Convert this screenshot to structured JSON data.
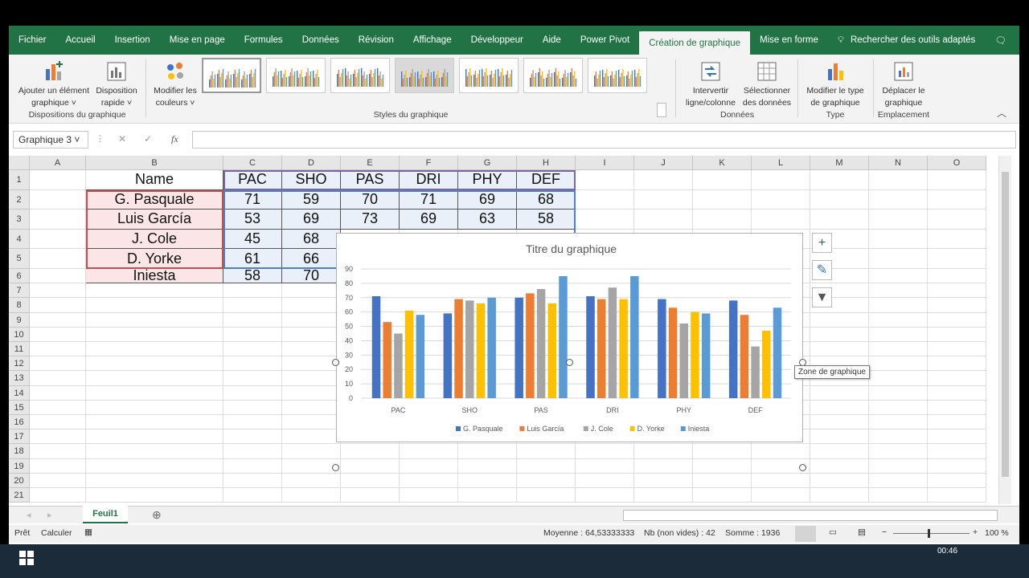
{
  "menu": {
    "tabs": [
      "Fichier",
      "Accueil",
      "Insertion",
      "Mise en page",
      "Formules",
      "Données",
      "Révision",
      "Affichage",
      "Développeur",
      "Aide",
      "Power Pivot",
      "Création de graphique",
      "Mise en forme"
    ],
    "active": "Création de graphique",
    "search": "Rechercher des outils adaptés"
  },
  "ribbon": {
    "add_element": [
      "Ajouter un élément",
      "graphique ˅"
    ],
    "quick_layout": [
      "Disposition",
      "rapide ˅"
    ],
    "group_layouts": "Dispositions du graphique",
    "change_colors": [
      "Modifier les",
      "couleurs ˅"
    ],
    "group_styles": "Styles du graphique",
    "switch_rowcol": [
      "Intervertir",
      "ligne/colonne"
    ],
    "select_data": [
      "Sélectionner",
      "des données"
    ],
    "group_data": "Données",
    "change_type": [
      "Modifier le type",
      "de graphique"
    ],
    "group_type": "Type",
    "move_chart": [
      "Déplacer le",
      "graphique"
    ],
    "group_location": "Emplacement"
  },
  "formula": {
    "namebox": "Graphique 3 ˅",
    "fx": "fx",
    "cancel": "✕",
    "confirm": "✓"
  },
  "columns": [
    "A",
    "B",
    "C",
    "D",
    "E",
    "F",
    "G",
    "H",
    "I",
    "J",
    "K",
    "L",
    "M",
    "N",
    "O"
  ],
  "rows": [
    "1",
    "2",
    "3",
    "4",
    "5",
    "6",
    "7",
    "8",
    "9",
    "10",
    "11",
    "12",
    "13",
    "14",
    "15",
    "16",
    "17",
    "18",
    "19",
    "20",
    "21"
  ],
  "table": {
    "headers": [
      "Name",
      "PAC",
      "SHO",
      "PAS",
      "DRI",
      "PHY",
      "DEF"
    ],
    "data": [
      [
        "G. Pasquale",
        "71",
        "59",
        "70",
        "71",
        "69",
        "68"
      ],
      [
        "Luis García",
        "53",
        "69",
        "73",
        "69",
        "63",
        "58"
      ],
      [
        "J. Cole",
        "45",
        "68"
      ],
      [
        "D. Yorke",
        "61",
        "66"
      ],
      [
        "Iniesta",
        "58",
        "70"
      ]
    ]
  },
  "chart_data": {
    "type": "bar",
    "title": "Titre du graphique",
    "categories": [
      "PAC",
      "SHO",
      "PAS",
      "DRI",
      "PHY",
      "DEF"
    ],
    "series": [
      {
        "name": "G. Pasquale",
        "color": "#4472c4",
        "values": [
          71,
          59,
          70,
          71,
          69,
          68
        ]
      },
      {
        "name": "Luis García",
        "color": "#ed7d31",
        "values": [
          53,
          69,
          73,
          69,
          63,
          58
        ]
      },
      {
        "name": "J. Cole",
        "color": "#a5a5a5",
        "values": [
          45,
          68,
          76,
          77,
          52,
          36
        ]
      },
      {
        "name": "D. Yorke",
        "color": "#ffc000",
        "values": [
          61,
          66,
          66,
          69,
          60,
          47
        ]
      },
      {
        "name": "Iniesta",
        "color": "#5b9bd5",
        "values": [
          58,
          70,
          85,
          85,
          59,
          63
        ]
      }
    ],
    "ylim": [
      0,
      90
    ],
    "yticks": [
      "0",
      "10",
      "20",
      "30",
      "40",
      "50",
      "60",
      "70",
      "80",
      "90"
    ],
    "legend": "bottom",
    "grid": true
  },
  "tooltip": "Zone de graphique",
  "sheet": {
    "tab": "Feuil1",
    "add": "⊕"
  },
  "status": {
    "ready": "Prêt",
    "calc": "Calculer",
    "avg": "Moyenne : 64,53333333",
    "count": "Nb (non vides) : 42",
    "sum": "Somme : 1936",
    "zoom": "100 %",
    "minus": "−",
    "plus": "+"
  },
  "clock": "00:46"
}
